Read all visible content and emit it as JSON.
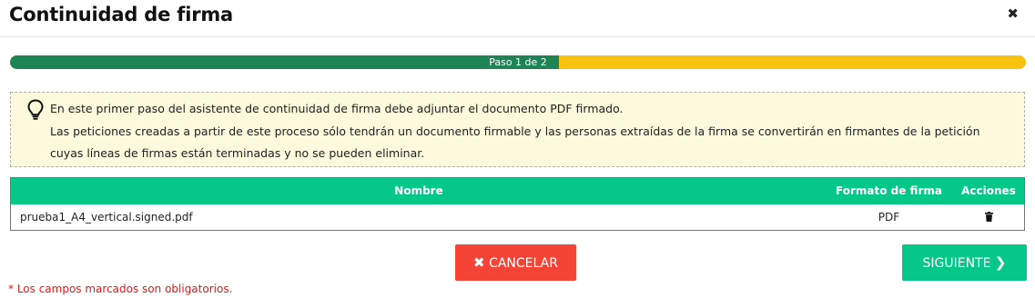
{
  "dialog": {
    "title": "Continuidad de firma",
    "close_symbol": "✖"
  },
  "progress": {
    "label": "Paso 1 de 2",
    "current_step": 1,
    "total_steps": 2,
    "fraction": 0.54,
    "fill_color": "#1e8456",
    "track_color": "#f7c30f"
  },
  "info": {
    "icon": "lightbulb-icon",
    "line1": "En este primer paso del asistente de continuidad de firma debe adjuntar el documento PDF firmado.",
    "line2": "Las peticiones creadas a partir de este proceso sólo tendrán un documento firmable y las personas extraídas de la firma se convertirán en firmantes de la petición",
    "line3": "cuyas líneas de firmas están terminadas y no se pueden eliminar."
  },
  "table": {
    "headers": {
      "name": "Nombre",
      "format": "Formato de firma",
      "actions": "Acciones"
    },
    "rows": [
      {
        "name": "prueba1_A4_vertical.signed.pdf",
        "format": "PDF",
        "action_icon": "trash-icon"
      }
    ],
    "header_color": "#05c788"
  },
  "buttons": {
    "cancel_label": "CANCELAR",
    "cancel_icon": "✖",
    "next_label": "SIGUIENTE",
    "next_icon": "❯",
    "cancel_color": "#f44436",
    "next_color": "#05c788"
  },
  "footer": {
    "required_note": "* Los campos marcados son obligatorios."
  }
}
